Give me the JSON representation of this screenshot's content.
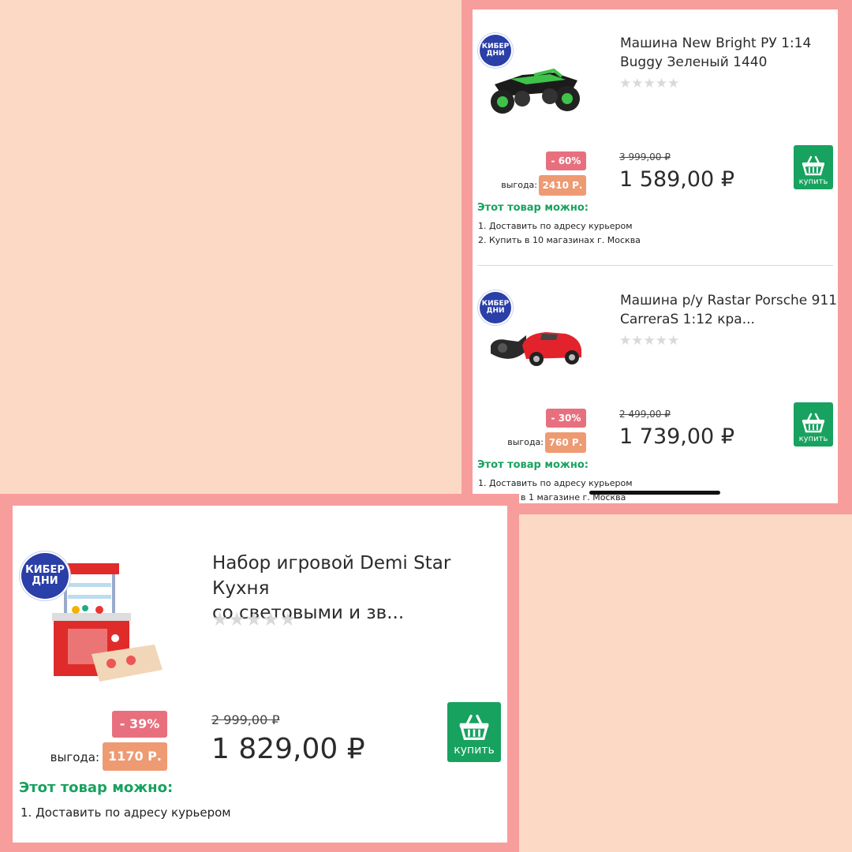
{
  "products": [
    {
      "badge_line1": "КИБЕР",
      "badge_line2": "ДНИ",
      "image_icon": "green-rc-buggy-image",
      "title_line1": "Машина New Bright РУ 1:14",
      "title_line2": "Buggy Зеленый 1440",
      "rating": 0,
      "discount": "- 60%",
      "savings_label": "выгода:",
      "savings_value": "2410 Р.",
      "old_price": "3 999,00 ₽",
      "price": "1 589,00 ₽",
      "buy_label": "купить",
      "options_title": "Этот товар можно:",
      "options": [
        "1.  Доставить по адресу курьером",
        "2.  Купить в 10 магазинах г. Москва"
      ]
    },
    {
      "badge_line1": "КИБЕР",
      "badge_line2": "ДНИ",
      "image_icon": "red-rc-porsche-image",
      "title_line1": "Машина р/у Rastar Porsche 911",
      "title_line2": "CarreraS 1:12 кра...",
      "rating": 0,
      "discount": "- 30%",
      "savings_label": "выгода:",
      "savings_value": "760 Р.",
      "old_price": "2 499,00 ₽",
      "price": "1 739,00 ₽",
      "buy_label": "купить",
      "options_title": "Этот товар можно:",
      "options": [
        "1.  Доставить по адресу курьером",
        "в 1 магазине г. Москва"
      ]
    },
    {
      "badge_line1": "КИБЕР",
      "badge_line2": "ДНИ",
      "image_icon": "toy-kitchen-image",
      "title_line1": "Набор игровой Demi Star Кухня",
      "title_line2": "со световыми и зв...",
      "rating": 0,
      "discount": "- 39%",
      "savings_label": "выгода:",
      "savings_value": "1170 Р.",
      "old_price": "2 999,00 ₽",
      "price": "1 829,00 ₽",
      "buy_label": "купить",
      "options_title": "Этот товар можно:",
      "options": [
        "1.  Доставить по адресу курьером"
      ]
    }
  ],
  "colors": {
    "background": "#fcd9c4",
    "frame": "#f79d9c",
    "buy_button": "#18a25f",
    "discount_badge": "#e8707e",
    "savings_badge": "#ee9a72",
    "cyber_badge": "#2a3fa8"
  }
}
